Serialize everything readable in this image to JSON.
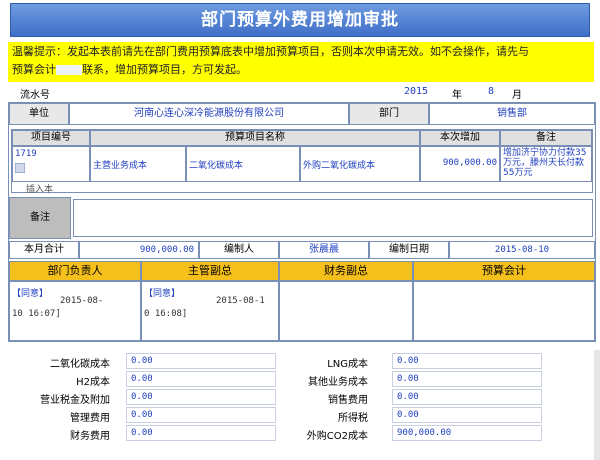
{
  "title": "部门预算外费用增加审批",
  "tip": {
    "line1": "温馨提示：发起本表前请先在部门费用预算底表中增加预算项目，否则本次申请无效。如不会操作，请先与",
    "line2a": "预算会计",
    "line2b": "联系，增加预算项目，方可发起。"
  },
  "serial": {
    "label": "流水号",
    "year": "2015",
    "year_unit": "年",
    "month": "8",
    "month_unit": "月"
  },
  "unit": {
    "label": "单位",
    "value": "河南心连心深冷能源股份有限公司",
    "dept_label": "部门",
    "dept_value": "销售部"
  },
  "items": {
    "headers": [
      "项目编号",
      "预算项目名称",
      "本次增加",
      "备注"
    ],
    "row": {
      "code": "1719",
      "code_note": "插入本",
      "name1": "主营业务成本",
      "name2": "二氧化碳成本",
      "name3": "外购二氧化碳成本",
      "amount": "900,000.00",
      "remark": "增加济宁协力付款35万元，滕州天长付款55万元"
    }
  },
  "remark_label": "备注",
  "total": {
    "label": "本月合计",
    "value": "900,000.00",
    "maker_label": "编制人",
    "maker": "张晨晨",
    "date_label": "编制日期",
    "date": "2015-08-10"
  },
  "approvals": {
    "headers": [
      "部门负责人",
      "主管副总",
      "财务副总",
      "预算会计"
    ],
    "a1": {
      "tag": "【同意】",
      "date1": "2015-08-",
      "date2": "10 16:07]"
    },
    "a2": {
      "tag": "【同意】",
      "date1": "2015-08-1",
      "date2": "0 16:08]"
    }
  },
  "summary": {
    "left": [
      {
        "label": "二氧化碳成本",
        "value": "0.00"
      },
      {
        "label": "H2成本",
        "value": "0.00"
      },
      {
        "label": "营业税金及附加",
        "value": "0.00"
      },
      {
        "label": "管理费用",
        "value": "0.00"
      },
      {
        "label": "财务费用",
        "value": "0.00"
      }
    ],
    "right": [
      {
        "label": "LNG成本",
        "value": "0.00"
      },
      {
        "label": "其他业务成本",
        "value": "0.00"
      },
      {
        "label": "销售费用",
        "value": "0.00"
      },
      {
        "label": "所得税",
        "value": "0.00"
      },
      {
        "label": "外购CO2成本",
        "value": "900,000.00"
      }
    ]
  },
  "colors": {
    "title_bg": "#3f6fc8",
    "tip_bg": "#ffff00",
    "approval_header": "#f5c01b",
    "value_text": "#1f3fbf"
  }
}
